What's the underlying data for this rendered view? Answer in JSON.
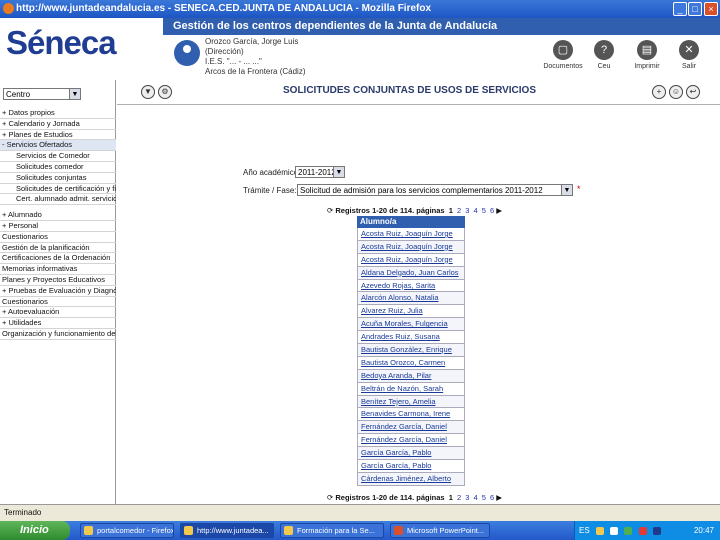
{
  "window": {
    "title": "http://www.juntadeandalucia.es - SENECA.CED.JUNTA DE ANDALUCIA - Mozilla Firefox"
  },
  "header": {
    "logo_text": "Séneca",
    "banner": "Gestión de los centros dependientes de la Junta de Andalucía",
    "user_lines": [
      "Orozco García, Jorge Luis",
      "(Dirección)",
      "I.E.S. \"... - ... ...\"",
      "Arcos de la Frontera (Cádiz)"
    ],
    "buttons": [
      {
        "label": "Documentos",
        "icon": "documents-icon"
      },
      {
        "label": "Ceu",
        "icon": "help-icon"
      },
      {
        "label": "Imprimir",
        "icon": "print-icon"
      },
      {
        "label": "Salir",
        "icon": "exit-icon"
      }
    ]
  },
  "sidebar": {
    "profile_select": "Centro",
    "items": [
      {
        "label": "+ Datos propios",
        "sub": false
      },
      {
        "label": "+ Calendario y Jornada",
        "sub": false
      },
      {
        "label": "+ Planes de Estudios",
        "sub": false
      },
      {
        "label": "- Servicios Ofertados",
        "sub": false,
        "selected": true
      },
      {
        "label": "Servicios de Comedor",
        "sub": true
      },
      {
        "label": "Solicitudes comedor",
        "sub": true
      },
      {
        "label": "Solicitudes conjuntas",
        "sub": true
      },
      {
        "label": "Solicitudes de certificación y firma",
        "sub": true
      },
      {
        "label": "Cert. alumnado admit. servicio",
        "sub": true
      },
      {
        "label": "",
        "spacer": true
      },
      {
        "label": "+ Alumnado",
        "sub": false
      },
      {
        "label": "+ Personal",
        "sub": false
      },
      {
        "label": "Cuestionarios",
        "sub": false
      },
      {
        "label": "Gestión de la planificación",
        "sub": false
      },
      {
        "label": "Certificaciones de la Ordenación",
        "sub": false
      },
      {
        "label": "Memorias informativas",
        "sub": false
      },
      {
        "label": "Planes y Proyectos Educativos",
        "sub": false
      },
      {
        "label": "+ Pruebas de Evaluación y Diagnóstico",
        "sub": false
      },
      {
        "label": "Cuestionarios",
        "sub": false
      },
      {
        "label": "+ Autoevaluación",
        "sub": false
      },
      {
        "label": "+ Utilidades",
        "sub": false
      },
      {
        "label": "Organización y funcionamiento del Centro",
        "sub": false
      }
    ]
  },
  "page": {
    "title": "SOLICITUDES CONJUNTAS DE USOS DE SERVICIOS",
    "year_label": "Año académico:",
    "year_value": "2011-2012",
    "process_label": "Trámite / Fase:",
    "process_value": "Solicitud de admisión para los servicios complementarios 2011-2012",
    "pager": {
      "text": "Registros 1-20 de 114. páginas",
      "pages": [
        "1",
        "2",
        "3",
        "4",
        "5",
        "6"
      ]
    },
    "list_header": "Alumno/a",
    "rows": [
      "Acosta Ruiz, Joaquín Jorge",
      "Acosta Ruiz, Joaquín Jorge",
      "Acosta Ruiz, Joaquín Jorge",
      "Aldana Delgado, Juan Carlos",
      "Azevedo Rojas, Sarita",
      "Alarcón Alonso, Natalia",
      "Alvarez Ruiz, Julia",
      "Acuña Morales, Fulgencia",
      "Andrades Ruiz, Susana",
      "Bautista González, Enrique",
      "Bautista Orozco, Carmen",
      "Bedoya Aranda, Pilar",
      "Beltrán de Nazón, Sarah",
      "Benítez Tejero, Amelia",
      "Benavides Carmona, Irene",
      "Fernández García, Daniel",
      "Fernández García, Daniel",
      "García García, Pablo",
      "García García, Pablo",
      "Cárdenas Jiménez, Alberto"
    ]
  },
  "status": {
    "text": "Terminado"
  },
  "taskbar": {
    "start": "Inicio",
    "items": [
      "portalcomedor - Firefox",
      "http://www.juntadea...",
      "Formación para la Se...",
      "Microsoft PowerPoint..."
    ],
    "lang": "ES",
    "clock": "20:47"
  }
}
